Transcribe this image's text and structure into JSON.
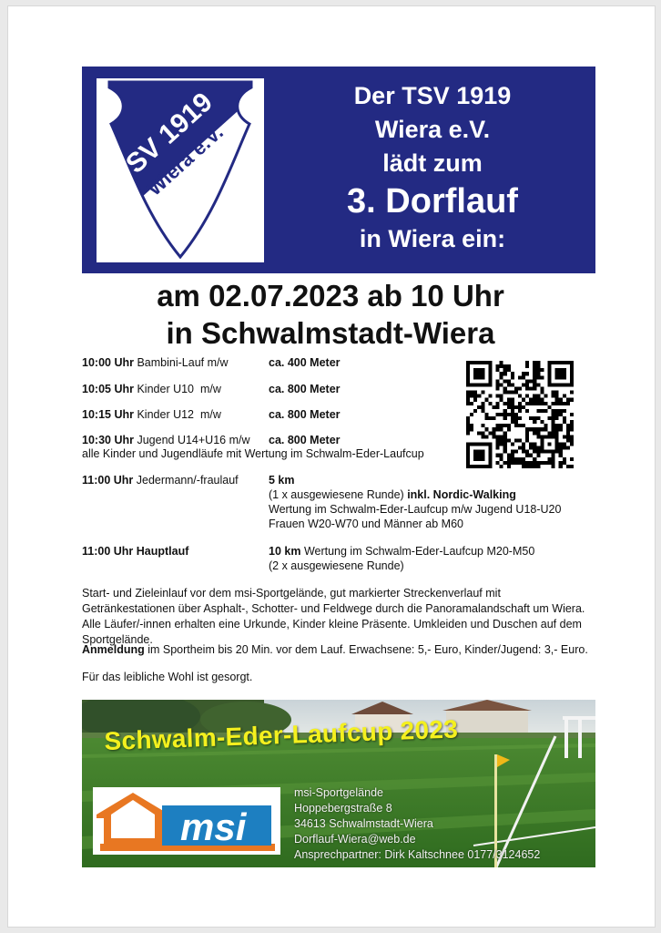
{
  "header": {
    "logo_text_line1": "TSV 1919",
    "logo_text_line2": "Wiera e.V.",
    "line1": "Der TSV 1919",
    "line2": "Wiera e.V.",
    "line3": "lädt zum",
    "line4": "3. Dorflauf",
    "line5": "in Wiera ein:"
  },
  "date_line1": "am 02.07.2023 ab 10 Uhr",
  "date_line2": "in Schwalmstadt-Wiera",
  "schedule": [
    {
      "time": "10:00 Uhr",
      "event": "Bambini-Lauf m/w",
      "distance": "ca. 400 Meter"
    },
    {
      "time": "10:05 Uhr",
      "event": "Kinder U10  m/w",
      "distance": "ca. 800 Meter"
    },
    {
      "time": "10:15 Uhr",
      "event": "Kinder U12  m/w",
      "distance": "ca. 800 Meter"
    },
    {
      "time": "10:30 Uhr",
      "event": "Jugend U14+U16 m/w",
      "distance": "ca. 800 Meter"
    }
  ],
  "kids_note": "alle Kinder und Jugendläufe mit Wertung im Schwalm-Eder-Laufcup",
  "jedermann": {
    "time": "11:00 Uhr",
    "event": "Jedermann/-fraulauf",
    "distance": "5 km",
    "rounds": "(1 x ausgewiesene Runde)",
    "extra": "inkl. Nordic-Walking",
    "wertung1": "Wertung im Schwalm-Eder-Laufcup m/w Jugend U18-U20",
    "wertung2": "Frauen W20-W70 und Männer ab M60"
  },
  "hauptlauf": {
    "time": "11:00 Uhr",
    "event": "Hauptlauf",
    "distance": "10 km",
    "wertung": "Wertung im Schwalm-Eder-Laufcup M20-M50",
    "rounds": "(2 x ausgewiesene Runde)"
  },
  "info_paragraph": "Start- und Zieleinlauf vor dem msi-Sportgelände, gut markierter Streckenverlauf mit Getränkestationen über Asphalt-, Schotter- und Feldwege durch die Panoramalandschaft um Wiera. Alle Läufer/-innen erhalten eine Urkunde, Kinder kleine Präsente. Umkleiden und Duschen auf dem Sportgelände.",
  "anmeldung_label": "Anmeldung",
  "anmeldung_text": " im Sportheim bis 20 Min. vor dem Lauf. Erwachsene: 5,- Euro, Kinder/Jugend: 3,- Euro.",
  "food_note": "Für das leibliche Wohl ist gesorgt.",
  "banner": {
    "title": "Schwalm-Eder-Laufcup 2023",
    "logo_text": "msi",
    "address": [
      "msi-Sportgelände",
      "Hoppebergstraße 8",
      "34613 Schwalmstadt-Wiera",
      "Dorflauf-Wiera@web.de",
      "Ansprechpartner: Dirk Kaltschnee 0177/3124652"
    ]
  },
  "colors": {
    "header_bg": "#232a83",
    "cup_title": "#f4f01e",
    "msi_orange": "#e87722",
    "msi_blue": "#1d7fc1"
  },
  "icons": [
    "qr-code-icon",
    "club-crest-icon",
    "msi-house-icon"
  ]
}
